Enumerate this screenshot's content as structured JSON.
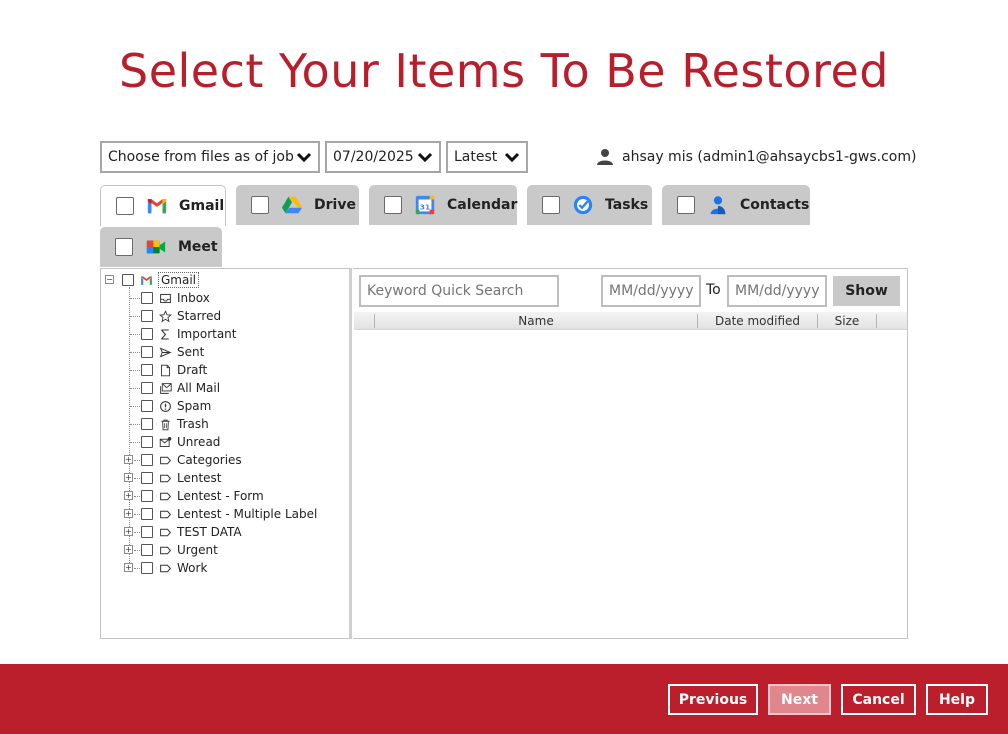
{
  "page_title": "Select Your Items To Be Restored",
  "filters": {
    "job_select": "Choose from files as of job",
    "date_select": "07/20/2025",
    "version_select": "Latest"
  },
  "user": {
    "label": "ahsay mis (admin1@ahsaycbs1-gws.com)",
    "icon": "person-icon"
  },
  "tabs": [
    {
      "label": "Gmail",
      "icon": "gmail-icon",
      "active": true
    },
    {
      "label": "Drive",
      "icon": "drive-icon"
    },
    {
      "label": "Calendar",
      "icon": "calendar-icon"
    },
    {
      "label": "Tasks",
      "icon": "tasks-icon"
    },
    {
      "label": "Contacts",
      "icon": "contacts-icon"
    },
    {
      "label": "Meet",
      "icon": "meet-icon"
    }
  ],
  "tree": {
    "root": "Gmail",
    "items": [
      {
        "label": "Inbox",
        "icon": "inbox-icon",
        "expandable": false
      },
      {
        "label": "Starred",
        "icon": "star-icon",
        "expandable": false
      },
      {
        "label": "Important",
        "icon": "important-icon",
        "expandable": false
      },
      {
        "label": "Sent",
        "icon": "sent-icon",
        "expandable": false
      },
      {
        "label": "Draft",
        "icon": "draft-icon",
        "expandable": false
      },
      {
        "label": "All Mail",
        "icon": "all-mail-icon",
        "expandable": false
      },
      {
        "label": "Spam",
        "icon": "spam-icon",
        "expandable": false
      },
      {
        "label": "Trash",
        "icon": "trash-icon",
        "expandable": false
      },
      {
        "label": "Unread",
        "icon": "unread-icon",
        "expandable": false
      },
      {
        "label": "Categories",
        "icon": "label-icon",
        "expandable": true
      },
      {
        "label": "Lentest",
        "icon": "label-icon",
        "expandable": true
      },
      {
        "label": "Lentest - Form",
        "icon": "label-icon",
        "expandable": true
      },
      {
        "label": "Lentest - Multiple Label",
        "icon": "label-icon",
        "expandable": true
      },
      {
        "label": "TEST DATA",
        "icon": "label-icon",
        "expandable": true
      },
      {
        "label": "Urgent",
        "icon": "label-icon",
        "expandable": true
      },
      {
        "label": "Work",
        "icon": "label-icon",
        "expandable": true
      }
    ]
  },
  "search": {
    "keyword_placeholder": "Keyword Quick Search",
    "date_placeholder": "MM/dd/yyyy",
    "to_label": "To",
    "show_label": "Show"
  },
  "table": {
    "columns": [
      "Name",
      "Date modified",
      "Size"
    ]
  },
  "footer": {
    "previous": "Previous",
    "next": "Next",
    "cancel": "Cancel",
    "help": "Help"
  },
  "colors": {
    "brand_red": "#bb1f2c",
    "title_red": "#b81f2d",
    "tab_inactive": "#c9c9c9"
  }
}
